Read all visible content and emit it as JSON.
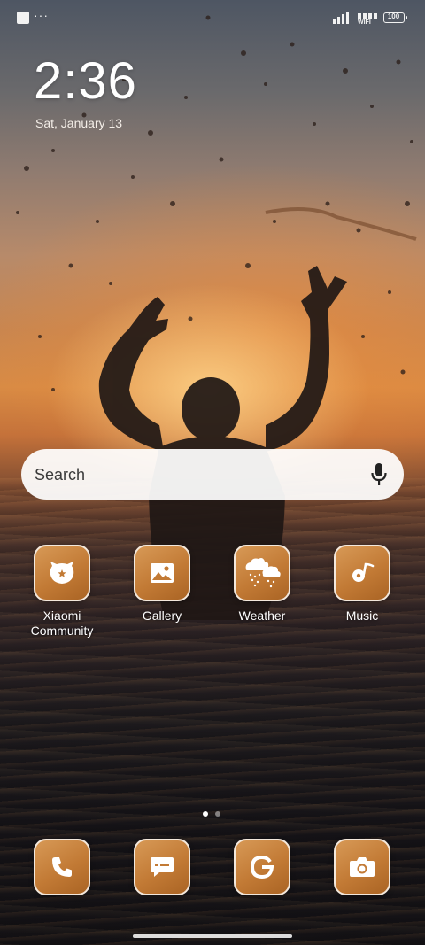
{
  "status_bar": {
    "more": "···",
    "wifi_label": "WIFI",
    "battery": "100"
  },
  "clock": {
    "time": "2:36",
    "date": "Sat, January 13"
  },
  "search": {
    "label": "Search",
    "icon": "microphone-icon"
  },
  "apps": [
    {
      "label": "Xiaomi Community",
      "icon": "xiaomi-community-icon"
    },
    {
      "label": "Gallery",
      "icon": "gallery-icon"
    },
    {
      "label": "Weather",
      "icon": "weather-icon"
    },
    {
      "label": "Music",
      "icon": "music-icon"
    }
  ],
  "page_indicator": {
    "pages": 2,
    "current": 1
  },
  "dock": [
    {
      "icon": "phone-icon"
    },
    {
      "icon": "messages-icon"
    },
    {
      "icon": "google-icon"
    },
    {
      "icon": "camera-icon"
    }
  ],
  "colors": {
    "icon_fill": "#c27a35",
    "icon_border": "#f3e8dc"
  }
}
